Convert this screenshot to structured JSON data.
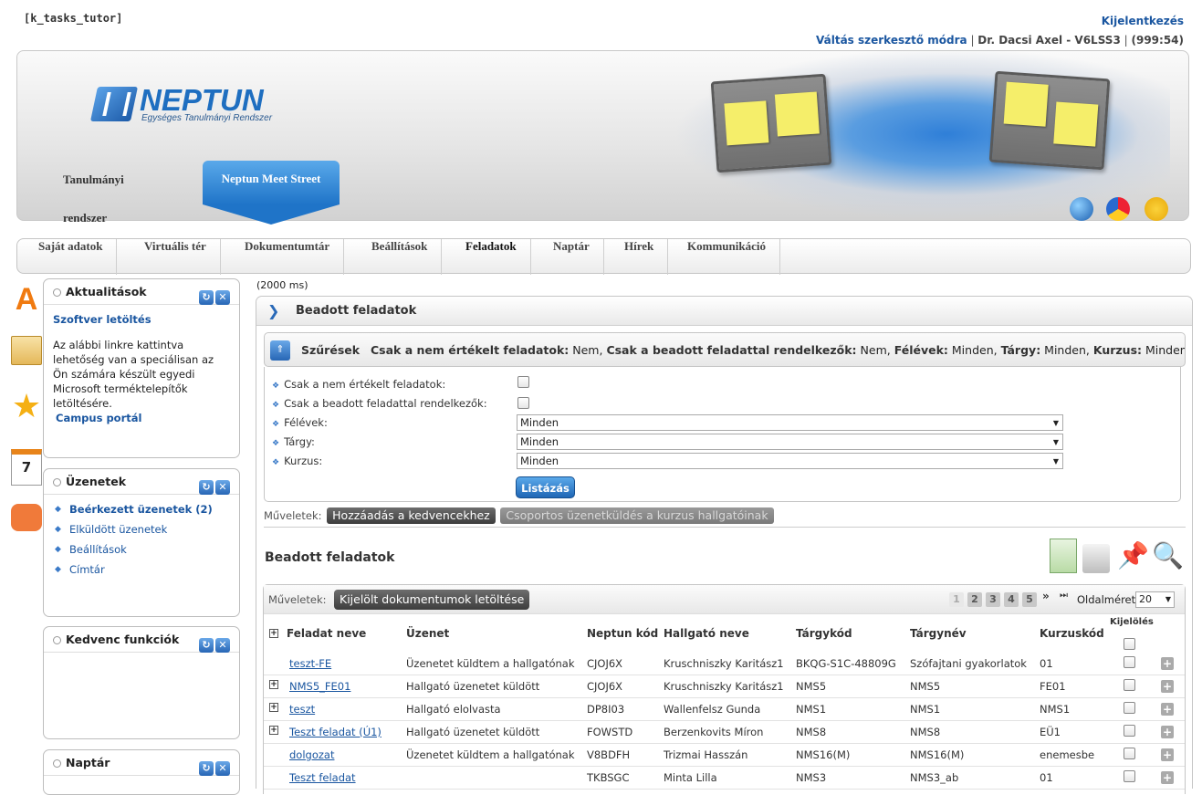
{
  "top": {
    "session_label": "[k_tasks_tutor]",
    "logout": "Kijelentkezés",
    "edit_mode": "Váltás szerkesztő módra",
    "user": "Dr. Dacsi Axel - V6LSS3",
    "timer": "(999:54)"
  },
  "banner": {
    "logo_name": "NEPTUN",
    "logo_sub": "Egységes Tanulmányi Rendszer",
    "tab_study": "Tanulmányi rendszer",
    "tab_meet": "Neptun Meet Street"
  },
  "menu": [
    "Saját adatok",
    "Virtuális tér",
    "Dokumentumtár",
    "Beállítások",
    "Feladatok",
    "Naptár",
    "Hírek",
    "Kommunikáció"
  ],
  "menu_active": "Feladatok",
  "sidebar": {
    "news": {
      "title": "Aktualitások",
      "link_title": "Szoftver letöltés",
      "text": "Az alábbi linkre kattintva lehetőség van a speciálisan az Ön számára készült egyedi Microsoft terméktelepítők letöltésére.",
      "link": "Campus portál"
    },
    "messages": {
      "title": "Üzenetek",
      "items": [
        "Beérkezett üzenetek (2)",
        "Elküldött üzenetek",
        "Beállítások",
        "Címtár"
      ]
    },
    "favorites": {
      "title": "Kedvenc funkciók"
    },
    "calendar": {
      "title": "Naptár",
      "icon_day": "7"
    }
  },
  "timing": "(2000 ms)",
  "main": {
    "title": "Beadott feladatok",
    "filter_label": "Szűrések",
    "filter_summary": [
      {
        "k": "Csak a nem értékelt feladatok:",
        "v": "Nem,"
      },
      {
        "k": "Csak a beadott feladattal rendelkezők:",
        "v": "Nem,"
      },
      {
        "k": "Félévek:",
        "v": "Minden,"
      },
      {
        "k": "Tárgy:",
        "v": "Minden,"
      },
      {
        "k": "Kurzus:",
        "v": "Minden"
      }
    ],
    "filters": {
      "not_rated": "Csak a nem értékelt feladatok:",
      "submitted_only": "Csak a beadott feladattal rendelkezők:",
      "semesters": "Félévek:",
      "subject": "Tárgy:",
      "course": "Kurzus:",
      "semesters_value": "Minden",
      "subject_value": "Minden",
      "course_value": "Minden"
    },
    "list_button": "Listázás",
    "ops_label": "Műveletek:",
    "op_add_fav": "Hozzáadás a kedvencekhez",
    "op_group_msg": "Csoportos üzenetküldés a kurzus hallgatóinak",
    "table_title": "Beadott feladatok",
    "op_download": "Kijelölt dokumentumok letöltése",
    "pages": [
      "1",
      "2",
      "3",
      "4",
      "5"
    ],
    "page_nav": "»",
    "page_last": "⏭",
    "page_size_label": "Oldalméret",
    "page_size": "20",
    "columns": [
      "Feladat neve",
      "Üzenet",
      "Neptun kód",
      "Hallgató neve",
      "Tárgykód",
      "Tárgynév",
      "Kurzuskód",
      "Kijelölés"
    ],
    "rows": [
      {
        "name": "teszt-FE",
        "msg": "Üzenetet küldtem a hallgatónak",
        "code": "CJOJ6X",
        "student": "Kruschniszky Karitász1",
        "subj_code": "BKQG-S1C-48809G",
        "subj_name": "Szófajtani gyakorlatok",
        "course": "01",
        "expand": false
      },
      {
        "name": "NMS5_FE01",
        "msg": "Hallgató üzenetet küldött",
        "code": "CJOJ6X",
        "student": "Kruschniszky Karitász1",
        "subj_code": "NMS5",
        "subj_name": "NMS5",
        "course": "FE01",
        "expand": true
      },
      {
        "name": "teszt",
        "msg": "Hallgató elolvasta",
        "code": "DP8I03",
        "student": "Wallenfelsz Gunda",
        "subj_code": "NMS1",
        "subj_name": "NMS1",
        "course": "NMS1",
        "expand": true
      },
      {
        "name": "Teszt feladat (Ú1)",
        "msg": "Hallgató üzenetet küldött",
        "code": "FOWSTD",
        "student": "Berzenkovits Míron",
        "subj_code": "NMS8",
        "subj_name": "NMS8",
        "course": "EÜ1",
        "expand": true
      },
      {
        "name": "dolgozat",
        "msg": "Üzenetet küldtem a hallgatónak",
        "code": "V8BDFH",
        "student": "Trizmai Hasszán",
        "subj_code": "NMS16(M)",
        "subj_name": "NMS16(M)",
        "course": "enemesbe",
        "expand": false
      },
      {
        "name": "Teszt feladat",
        "msg": "",
        "code": "TKBSGC",
        "student": "Minta Lilla",
        "subj_code": "NMS3",
        "subj_name": "NMS3_ab",
        "course": "01",
        "expand": false
      }
    ]
  }
}
